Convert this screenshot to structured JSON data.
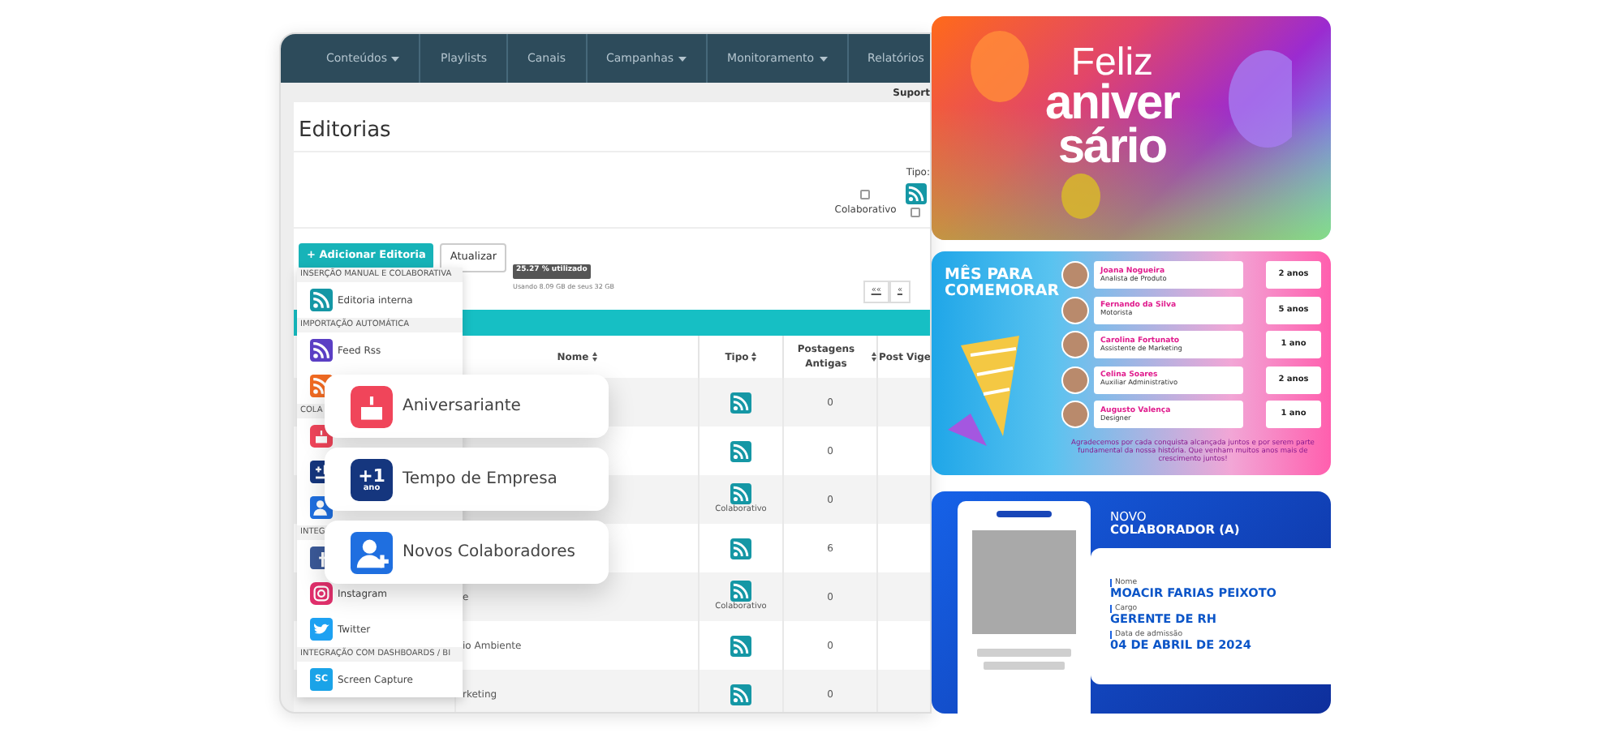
{
  "app": {
    "nav": [
      {
        "label": "Conteúdos",
        "dropdown": true
      },
      {
        "label": "Playlists",
        "dropdown": false
      },
      {
        "label": "Canais",
        "dropdown": false
      },
      {
        "label": "Campanhas",
        "dropdown": true
      },
      {
        "label": "Monitoramento",
        "dropdown": true
      },
      {
        "label": "Relatórios",
        "dropdown": false
      }
    ],
    "support_link": "Suport",
    "page_title": "Editorias",
    "filter": {
      "type_label": "Tipo:",
      "collaborative_label": "Colaborativo",
      "collaborative_checked": false,
      "type_checked": false
    },
    "add_button": "+ Adicionar Editoria",
    "refresh_button": "Atualizar",
    "usage_badge": "25.27 % utilizado",
    "usage_text": "Usando 8.09 GB de seus 32 GB",
    "pagination": [
      "««",
      "«"
    ],
    "columns": [
      {
        "label": "Nome",
        "sortable": true
      },
      {
        "label": "Tipo",
        "sortable": true
      },
      {
        "label": "Postagens Antigas",
        "sortable": true
      },
      {
        "label": "Post Vige",
        "sortable": false
      }
    ],
    "rows": [
      {
        "old_posts": "0"
      },
      {
        "old_posts": "0"
      },
      {
        "type_note": "Colaborativo",
        "old_posts": "0"
      },
      {
        "old_posts": "6"
      },
      {
        "name": "e",
        "type_note": "Colaborativo",
        "old_posts": "0"
      },
      {
        "name": "io Ambiente",
        "old_posts": "0"
      },
      {
        "name": "rketing",
        "old_posts": "0"
      }
    ],
    "menu": [
      {
        "kind": "header",
        "label": "INSERÇÃO MANUAL E COLABORATIVA"
      },
      {
        "kind": "rss",
        "color": "#1597a5",
        "label": "Editoria interna"
      },
      {
        "kind": "header",
        "label": "IMPORTAÇÃO AUTOMÁTICA"
      },
      {
        "kind": "rss",
        "color": "#5b3fc4",
        "label": "Feed Rss"
      },
      {
        "kind": "rss",
        "color": "#f06a22"
      },
      {
        "kind": "header",
        "label": "COLA"
      },
      {
        "kind": "cake",
        "color": "#f0455a"
      },
      {
        "kind": "plusone",
        "color": "#15367e"
      },
      {
        "kind": "person",
        "color": "#1f6fe0"
      },
      {
        "kind": "header",
        "label": "INTEG"
      },
      {
        "kind": "flogo",
        "color": "#3b5998"
      },
      {
        "kind": "ring",
        "color": "#e1306c",
        "label": "Instagram"
      },
      {
        "kind": "bird",
        "color": "#1da1f2",
        "label": "Twitter"
      },
      {
        "kind": "header",
        "label": "INTEGRAÇÃO COM DASHBOARDS / BI"
      },
      {
        "kind": "sc",
        "color": "#1aa3e8",
        "icon_text": "SC",
        "label": "Screen Capture"
      }
    ]
  },
  "highlights": [
    {
      "kind": "cake",
      "label": "Aniversariante"
    },
    {
      "kind": "plusone",
      "icon_big": "+1",
      "icon_small": "ano",
      "label": "Tempo de Empresa"
    },
    {
      "kind": "personadd",
      "label": "Novos Colaboradores"
    }
  ],
  "birthday_card": {
    "line1": "Feliz",
    "line2": "aniver",
    "line3": "sário"
  },
  "celebration_card": {
    "title_line1": "MÊS PARA",
    "title_line2": "COMEMORAR",
    "people": [
      {
        "name": "Joana Nogueira",
        "role": "Analista de Produto",
        "tenure": "2 anos"
      },
      {
        "name": "Fernando da Silva",
        "role": "Motorista",
        "tenure": "5 anos"
      },
      {
        "name": "Carolina Fortunato",
        "role": "Assistente de Marketing",
        "tenure": "1 ano"
      },
      {
        "name": "Celina Soares",
        "role": "Auxiliar Administrativo",
        "tenure": "2 anos"
      },
      {
        "name": "Augusto Valença",
        "role": "Designer",
        "tenure": "1 ano"
      }
    ],
    "message": "Agradecemos por cada conquista alcançada juntos e por serem parte fundamental da nossa história. Que venham muitos anos mais de crescimento juntos!"
  },
  "new_hire_card": {
    "title_line1": "NOVO",
    "title_line2": "COLABORADOR (A)",
    "fields": [
      {
        "label": "Nome",
        "value": "MOACIR FARIAS PEIXOTO"
      },
      {
        "label": "Cargo",
        "value": "GERENTE DE RH"
      },
      {
        "label": "Data de admissão",
        "value": "04 DE ABRIL DE 2024"
      }
    ]
  }
}
